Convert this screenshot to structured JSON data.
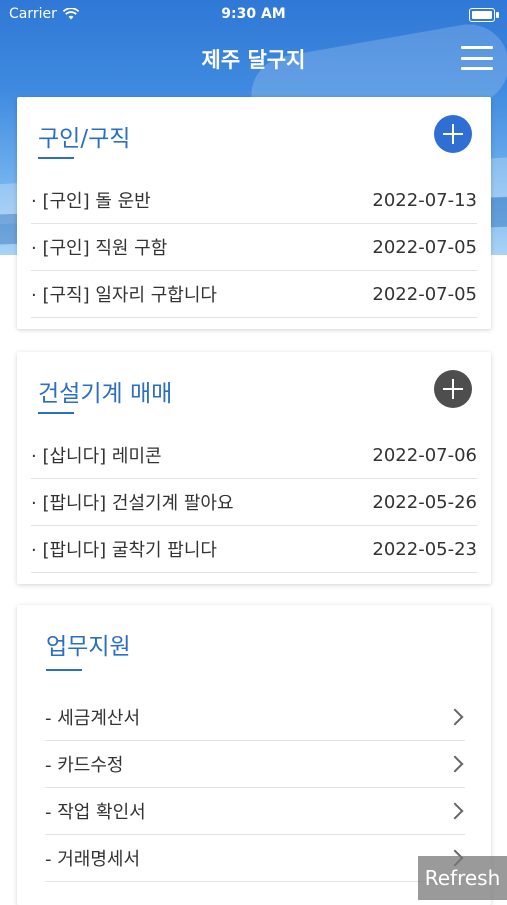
{
  "status": {
    "carrier": "Carrier",
    "time": "9:30 AM"
  },
  "header": {
    "title": "제주 달구지"
  },
  "jobs": {
    "title": "구인/구직",
    "items": [
      {
        "label": "· [구인] 돌 운반",
        "date": "2022-07-13"
      },
      {
        "label": "· [구인] 직원 구함",
        "date": "2022-07-05"
      },
      {
        "label": "· [구직] 일자리 구합니다",
        "date": "2022-07-05"
      }
    ]
  },
  "equipment": {
    "title": "건설기계 매매",
    "items": [
      {
        "label": "· [삽니다] 레미콘",
        "date": "2022-07-06"
      },
      {
        "label": "· [팝니다] 건설기계 팔아요",
        "date": "2022-05-26"
      },
      {
        "label": "· [팝니다] 굴착기 팝니다",
        "date": "2022-05-23"
      }
    ]
  },
  "support": {
    "title": "업무지원",
    "items": [
      {
        "label": "- 세금계산서"
      },
      {
        "label": "- 카드수정"
      },
      {
        "label": "- 작업 확인서"
      },
      {
        "label": "- 거래명세서"
      }
    ]
  },
  "refresh_label": "Refresh",
  "colors": {
    "accent": "#2a6fc4",
    "add_button_blue": "#2f6fd3",
    "add_button_dark": "#4e4e4e"
  },
  "icons": {
    "wifi": "wifi-icon",
    "battery": "battery-icon",
    "menu": "hamburger-menu-icon",
    "add": "plus-circle-icon",
    "chevron": "chevron-right-icon"
  }
}
